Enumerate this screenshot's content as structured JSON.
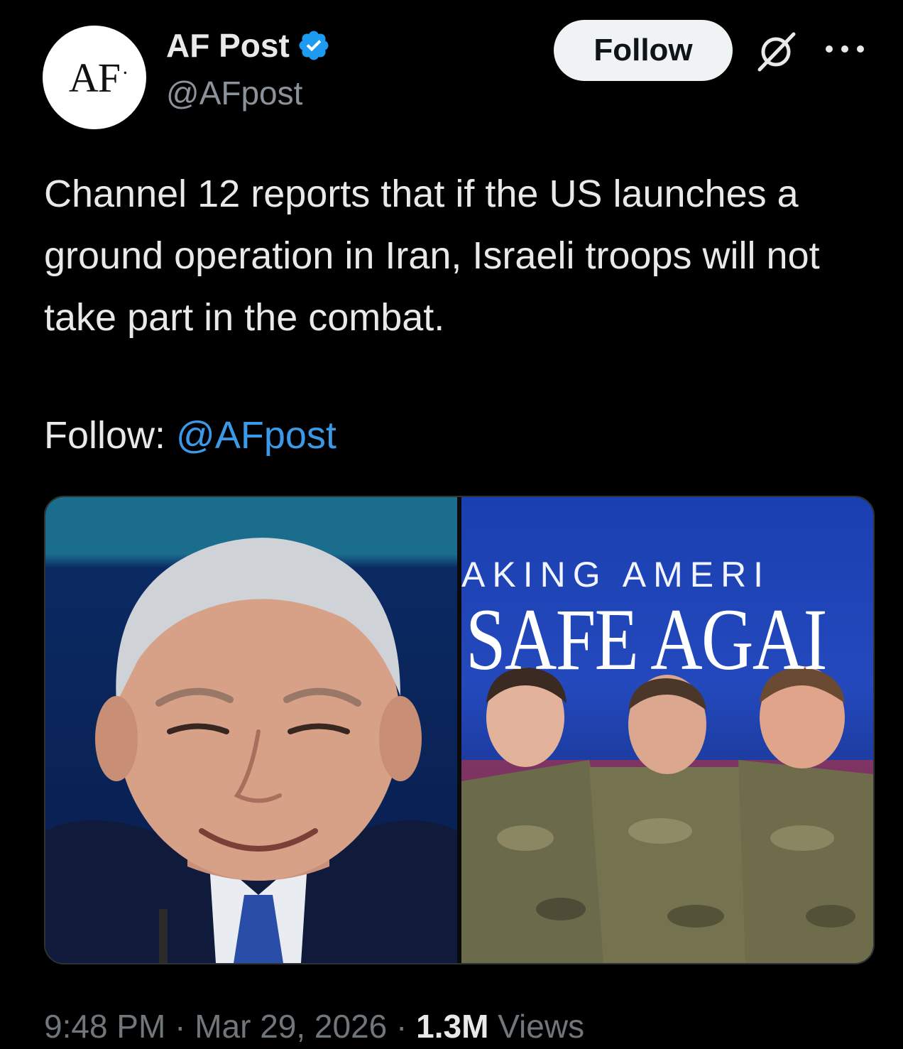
{
  "author": {
    "avatar_text": "AF",
    "avatar_dot": ".",
    "display_name": "AF Post",
    "handle": "@AFpost",
    "verified_color": "#1d9bf0"
  },
  "actions": {
    "follow_label": "Follow",
    "grok_icon": "grok-icon",
    "more_icon": "more-icon"
  },
  "post": {
    "text": "Channel 12 reports that if the US launches a ground operation in Iran, Israeli troops will not take part in the combat.",
    "follow_prefix": "Follow: ",
    "follow_mention": "@AFpost"
  },
  "media": {
    "right_banner_top": "AKING AMERI",
    "right_banner_main": "SAFE AGAI"
  },
  "meta": {
    "time": "9:48 PM",
    "separator": " · ",
    "date": "Mar 29, 2026",
    "views_count": "1.3M",
    "views_label": " Views"
  },
  "colors": {
    "background": "#000000",
    "text": "#e7e9ea",
    "muted": "#71767b",
    "link": "#3b9ae8"
  }
}
